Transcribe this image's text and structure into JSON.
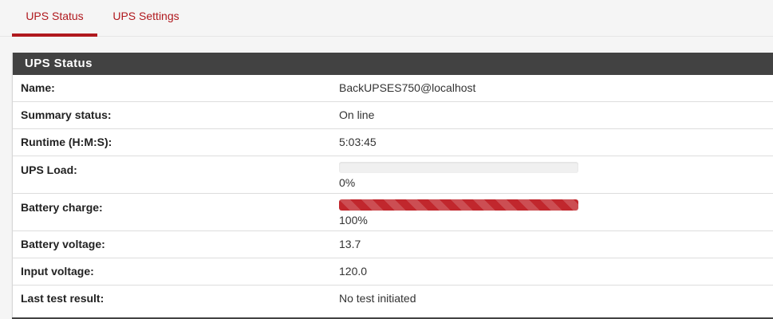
{
  "tabs": [
    {
      "label": "UPS Status",
      "active": true
    },
    {
      "label": "UPS Settings",
      "active": false
    }
  ],
  "panel": {
    "title": "UPS Status",
    "rows": [
      {
        "label": "Name:",
        "value": "BackUPSES750@localhost"
      },
      {
        "label": "Summary status:",
        "value": "On line"
      },
      {
        "label": "Runtime (H:M:S):",
        "value": "5:03:45"
      },
      {
        "label": "UPS Load:",
        "value": "0%",
        "percent": 0
      },
      {
        "label": "Battery charge:",
        "value": "100%",
        "percent": 100
      },
      {
        "label": "Battery voltage:",
        "value": "13.7"
      },
      {
        "label": "Input voltage:",
        "value": "120.0"
      },
      {
        "label": "Last test result:",
        "value": "No test initiated"
      }
    ]
  },
  "colors": {
    "accent": "#b0191e",
    "bar_fill": "#c1272d",
    "panel_header": "#424242"
  }
}
